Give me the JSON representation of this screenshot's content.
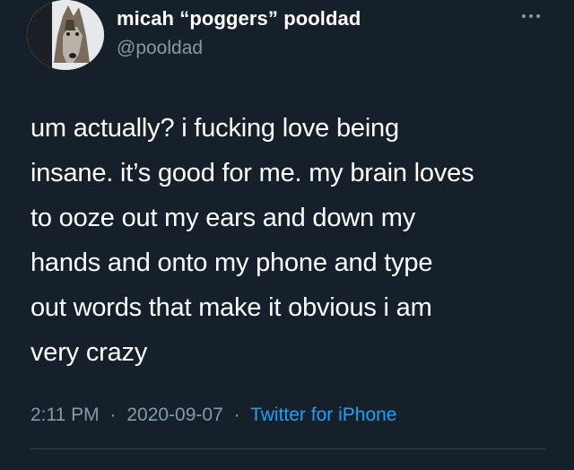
{
  "tweet": {
    "author": {
      "display_name": "micah “poggers” pooldad",
      "handle": "@pooldad"
    },
    "text_lines": [
      "um actually? i fucking love being",
      "insane. it’s good for me. my brain loves",
      "to ooze out my ears and down my",
      "hands and onto my phone and type",
      "out words that make it obvious i am",
      "very crazy"
    ],
    "time": "2:11 PM",
    "date": "2020-09-07",
    "separator": "·",
    "source": "Twitter for iPhone",
    "icons": {
      "avatar": "wolf-avatar",
      "more": "more-options-icon"
    },
    "colors": {
      "background": "#15202b",
      "text": "#ffffff",
      "secondary": "#8899a6",
      "link": "#1da1f2",
      "divider": "#38444d"
    }
  }
}
